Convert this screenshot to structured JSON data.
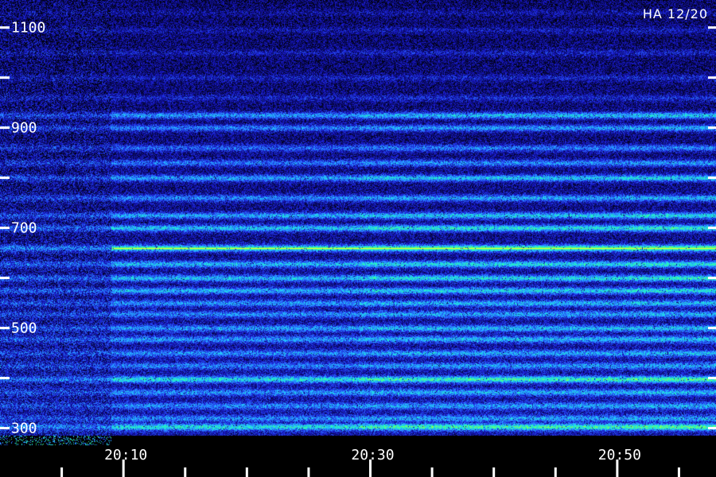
{
  "header": {
    "label": "HA 12/20"
  },
  "chart_data": {
    "type": "heatmap",
    "title": "",
    "xlabel": "",
    "ylabel": "",
    "x_tick_labels": [
      "20:10",
      "20:30",
      "20:50"
    ],
    "x_ticks": [
      "20:05",
      "20:10",
      "20:15",
      "20:20",
      "20:25",
      "20:30",
      "20:35",
      "20:40",
      "20:45",
      "20:50",
      "20:55"
    ],
    "y_tick_labels": [
      "300",
      "500",
      "700",
      "900",
      "1100"
    ],
    "y_ticks": [
      300,
      400,
      500,
      600,
      700,
      800,
      900,
      1000,
      1100
    ],
    "ylim": [
      285,
      1155
    ],
    "xlim": [
      "20:00",
      "20:58"
    ],
    "colormap": [
      "#000000",
      "#0a0a70",
      "#1a1ad0",
      "#2a6aff",
      "#22c8ff",
      "#22ffb0",
      "#a0ff40",
      "#ffff30"
    ],
    "bands": [
      {
        "y": 303,
        "intensity": 0.85
      },
      {
        "y": 320,
        "intensity": 0.5
      },
      {
        "y": 345,
        "intensity": 0.5
      },
      {
        "y": 372,
        "intensity": 0.55
      },
      {
        "y": 398,
        "intensity": 0.85
      },
      {
        "y": 425,
        "intensity": 0.5
      },
      {
        "y": 450,
        "intensity": 0.55
      },
      {
        "y": 478,
        "intensity": 0.6
      },
      {
        "y": 500,
        "intensity": 0.6
      },
      {
        "y": 528,
        "intensity": 0.55
      },
      {
        "y": 550,
        "intensity": 0.6
      },
      {
        "y": 575,
        "intensity": 0.7
      },
      {
        "y": 600,
        "intensity": 0.75
      },
      {
        "y": 628,
        "intensity": 0.75
      },
      {
        "y": 660,
        "intensity": 1.0
      },
      {
        "y": 700,
        "intensity": 0.8
      },
      {
        "y": 725,
        "intensity": 0.7
      },
      {
        "y": 760,
        "intensity": 0.6
      },
      {
        "y": 800,
        "intensity": 0.7
      },
      {
        "y": 830,
        "intensity": 0.55
      },
      {
        "y": 860,
        "intensity": 0.5
      },
      {
        "y": 900,
        "intensity": 0.6
      },
      {
        "y": 925,
        "intensity": 0.7
      },
      {
        "y": 960,
        "intensity": 0.35
      },
      {
        "y": 1000,
        "intensity": 0.3
      },
      {
        "y": 1050,
        "intensity": 0.3
      },
      {
        "y": 1095,
        "intensity": 0.25
      },
      {
        "y": 1130,
        "intensity": 0.2
      }
    ],
    "interference_line": {
      "y": 660,
      "from": "20:09",
      "to": "20:58",
      "color": "#ffff30"
    },
    "grid": false,
    "legend": "none"
  }
}
